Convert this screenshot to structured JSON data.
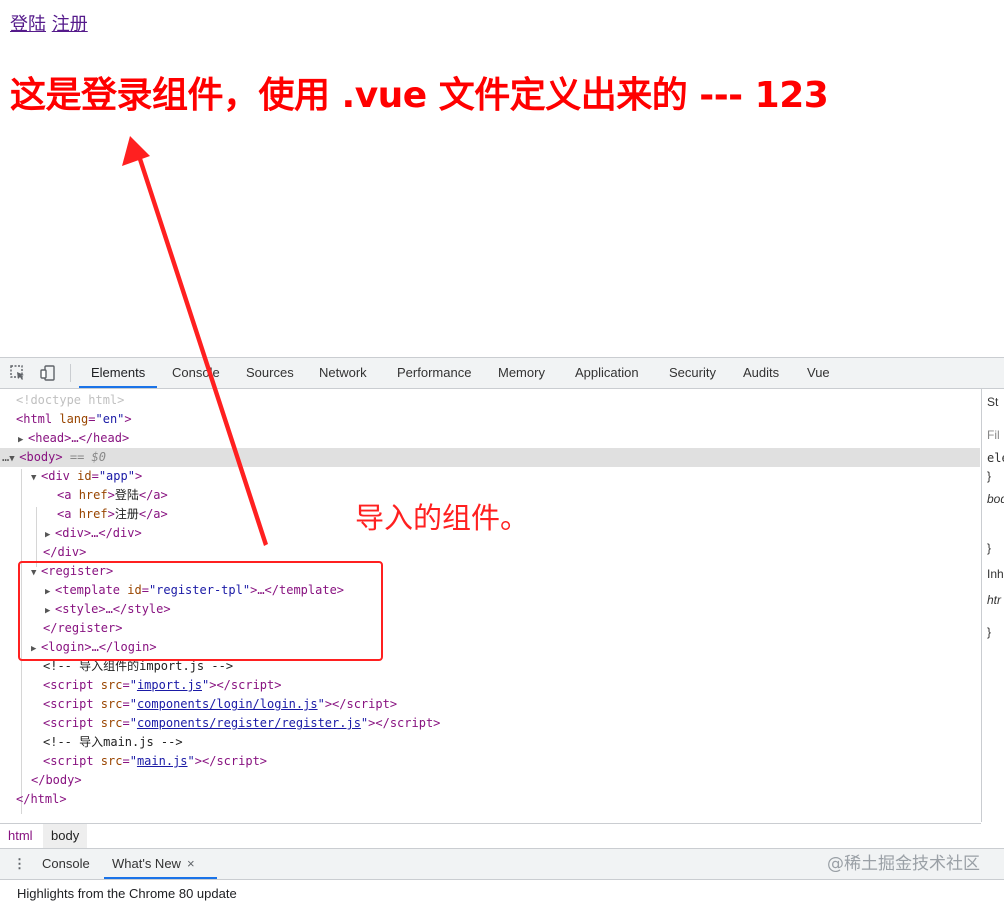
{
  "page": {
    "links": [
      "登陆",
      "注册"
    ],
    "headline": "这是登录组件，使用 .vue 文件定义出来的 --- 123"
  },
  "devtools": {
    "tabs": [
      "Elements",
      "Console",
      "Sources",
      "Network",
      "Performance",
      "Memory",
      "Application",
      "Security",
      "Audits",
      "Vue"
    ],
    "active_tab": "Elements",
    "side_pane": [
      "St",
      "Fil",
      "ele",
      "}",
      "bod",
      "}",
      "Inh",
      "htr",
      "}"
    ],
    "breadcrumbs": [
      "html",
      "body"
    ],
    "drawer": {
      "tabs": [
        "Console",
        "What's New"
      ],
      "active_tab": "What's New",
      "close_icon": "×",
      "content": "Highlights from the Chrome 80 update"
    }
  },
  "dom_tree": {
    "doctype": "<!doctype html>",
    "html_open": "<html",
    "html_lang_attr": "lang",
    "html_lang_val": "\"en\"",
    "head": "head",
    "body": "body",
    "selected_suffix": "== $0",
    "div_app_attr": "id",
    "div_app_val": "\"app\"",
    "a1_text": "登陆",
    "a2_text": "注册",
    "register": "register",
    "template_id_val": "\"register-tpl\"",
    "comment1": "<!-- 导入组件的import.js -->",
    "script1_src": "import.js",
    "script2_src": "components/login/login.js",
    "script3_src": "components/register/register.js",
    "comment2": "<!-- 导入main.js -->",
    "script4_src": "main.js"
  },
  "annotation": {
    "text": "导入的组件。",
    "color": "#ff2020"
  },
  "watermark": "@稀土掘金技术社区"
}
